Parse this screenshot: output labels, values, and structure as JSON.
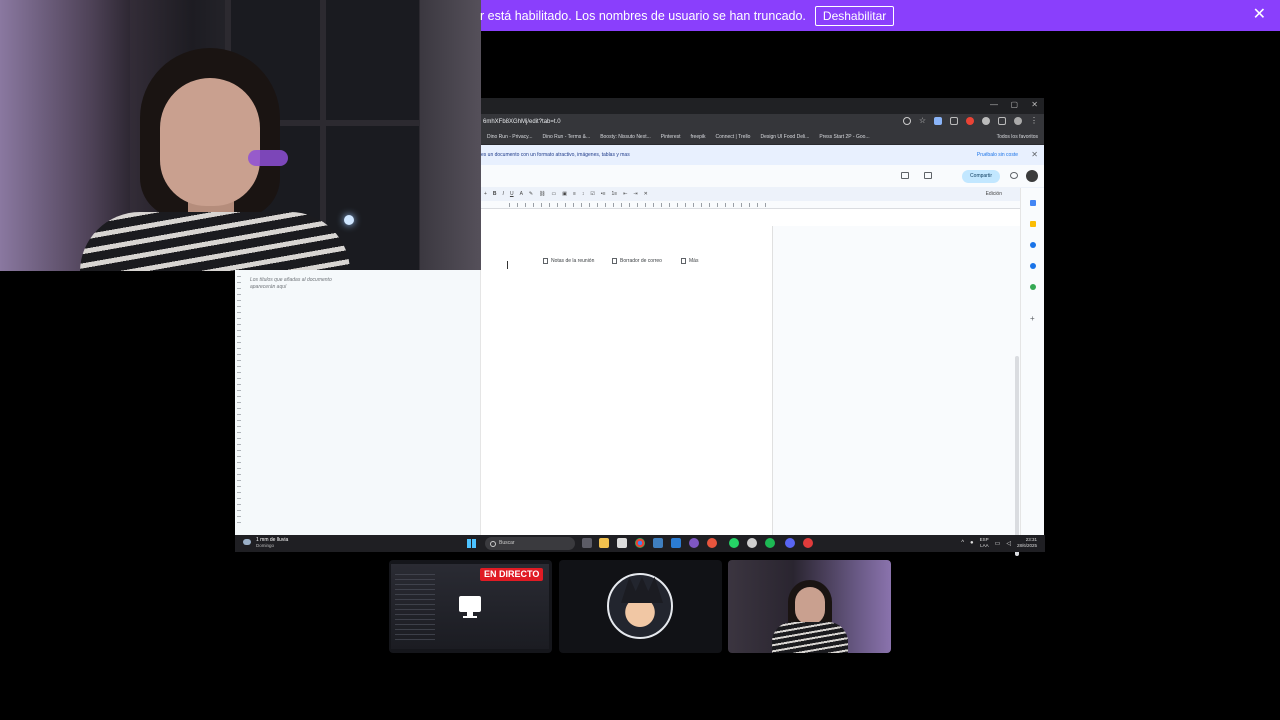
{
  "banner": {
    "text": "r está habilitado. Los nombres de usuario se han truncado.",
    "button_label": "Deshabilitar",
    "close_symbol": "✕",
    "color": "#8a3ffc"
  },
  "browser": {
    "url": "6mhXFb8XGhMj/edit?tab=t.0",
    "bookmarks": [
      "Dino Run - Privacy...",
      "Dino Run - Terms &...",
      "Boosty: Nissuto Next...",
      "Pinterest",
      "freepik",
      "Connect | Trello",
      "Design UI Food Deli...",
      "Press Start 2P - Goo..."
    ],
    "bookmarks_all": "Todos los favoritos",
    "promo_text": "es un documento con un formato atractivo, imágenes, tablas y mas",
    "promo_link": "Pruébalo sin coste",
    "share_label": "Compartir",
    "edit_mode": "Edición",
    "chips": [
      "Notas de la reunión",
      "Borrador de correo",
      "Más"
    ],
    "outline_hint": "Los títulos que añadas al documento aparecerán aquí"
  },
  "taskbar": {
    "weather_temp": "1 mm de lluvia",
    "weather_day": "Domingo",
    "search_placeholder": "Buscar",
    "lang": "ESP",
    "lang_sub": "LAA",
    "time": "23:31",
    "date": "28/6/2025"
  },
  "participants": {
    "live_badge": "EN DIRECTO"
  }
}
